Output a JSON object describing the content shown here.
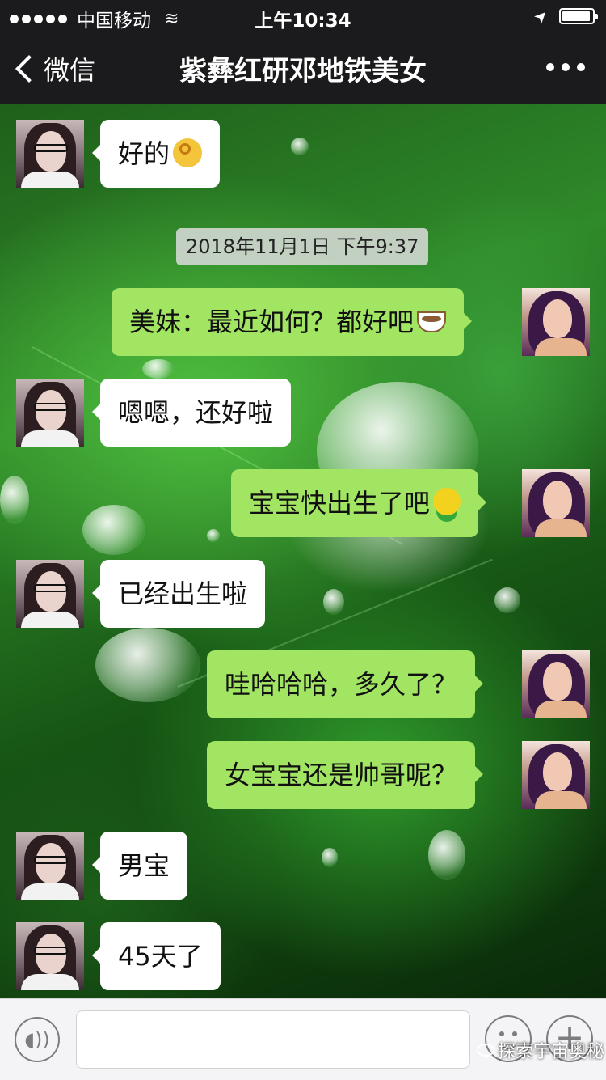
{
  "status_bar": {
    "carrier": "中国移动",
    "time": "上午10:34",
    "battery_level": 0.9
  },
  "nav": {
    "back_label": "微信",
    "title": "紫彝红研邓地铁美女"
  },
  "timestamp": "2018年11月1日 下午9:37",
  "messages": [
    {
      "from": "friend",
      "text": "好的",
      "emoji": "ok-hand-emoji"
    },
    {
      "from": "me",
      "text": "美妹：最近如何？都好吧",
      "emoji": "tea-cup-emoji"
    },
    {
      "from": "friend",
      "text": "嗯嗯，还好啦"
    },
    {
      "from": "me",
      "text": "宝宝快出生了吧",
      "emoji": "smiley-figure-emoji"
    },
    {
      "from": "friend",
      "text": "已经出生啦"
    },
    {
      "from": "me",
      "text": "哇哈哈哈，多久了？"
    },
    {
      "from": "me",
      "text": "女宝宝还是帅哥呢？"
    },
    {
      "from": "friend",
      "text": "男宝"
    },
    {
      "from": "friend",
      "text": "45天了"
    }
  ],
  "input_bar": {
    "voice_icon": "voice-icon",
    "emoji_icon": "emoji-face-icon",
    "plus_icon": "plus-icon"
  },
  "watermark": "探索宇宙奥秘",
  "colors": {
    "my_bubble": "#a2e563",
    "friend_bubble": "#ffffff",
    "bar": "#1b1b1d"
  }
}
